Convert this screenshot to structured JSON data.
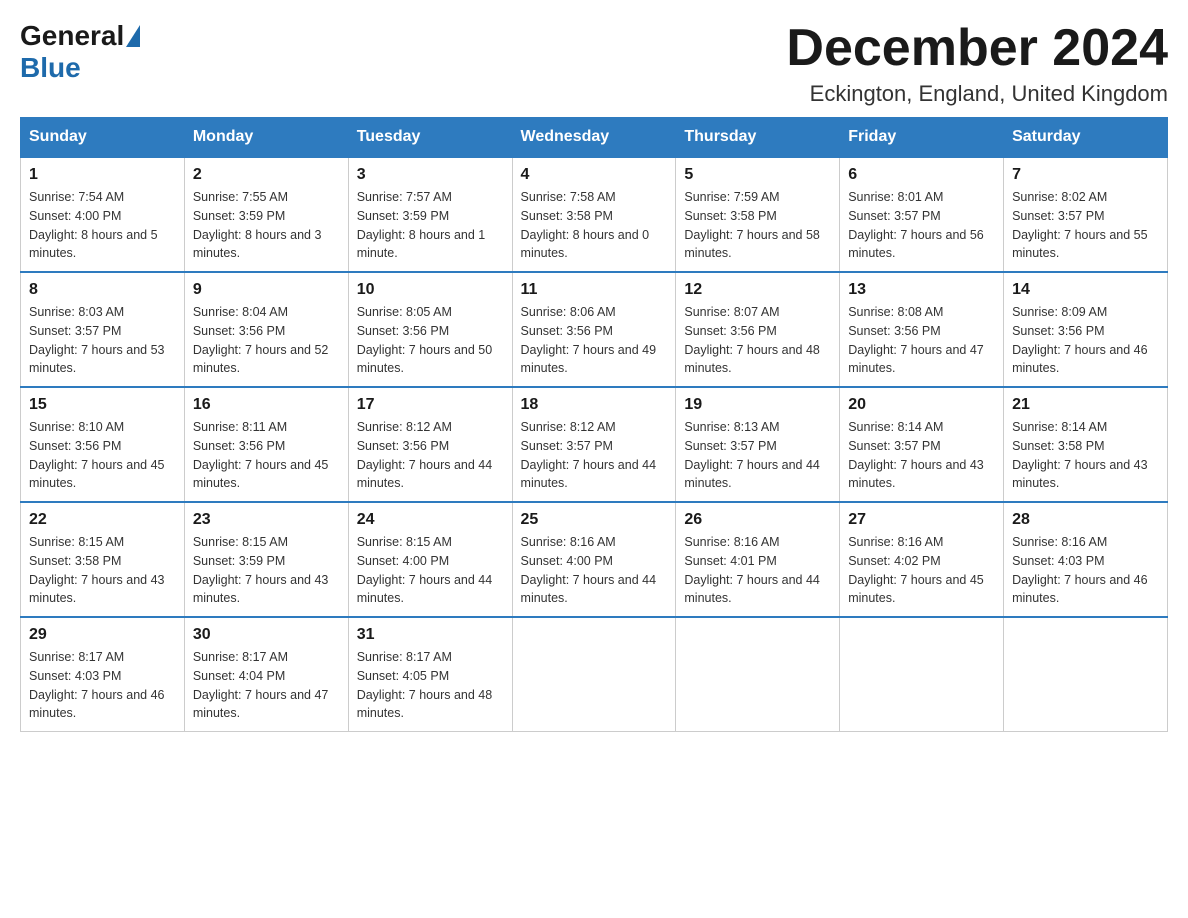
{
  "header": {
    "logo_general": "General",
    "logo_blue": "Blue",
    "month_title": "December 2024",
    "location": "Eckington, England, United Kingdom"
  },
  "days_of_week": [
    "Sunday",
    "Monday",
    "Tuesday",
    "Wednesday",
    "Thursday",
    "Friday",
    "Saturday"
  ],
  "weeks": [
    [
      {
        "day": "1",
        "sunrise": "7:54 AM",
        "sunset": "4:00 PM",
        "daylight": "8 hours and 5 minutes."
      },
      {
        "day": "2",
        "sunrise": "7:55 AM",
        "sunset": "3:59 PM",
        "daylight": "8 hours and 3 minutes."
      },
      {
        "day": "3",
        "sunrise": "7:57 AM",
        "sunset": "3:59 PM",
        "daylight": "8 hours and 1 minute."
      },
      {
        "day": "4",
        "sunrise": "7:58 AM",
        "sunset": "3:58 PM",
        "daylight": "8 hours and 0 minutes."
      },
      {
        "day": "5",
        "sunrise": "7:59 AM",
        "sunset": "3:58 PM",
        "daylight": "7 hours and 58 minutes."
      },
      {
        "day": "6",
        "sunrise": "8:01 AM",
        "sunset": "3:57 PM",
        "daylight": "7 hours and 56 minutes."
      },
      {
        "day": "7",
        "sunrise": "8:02 AM",
        "sunset": "3:57 PM",
        "daylight": "7 hours and 55 minutes."
      }
    ],
    [
      {
        "day": "8",
        "sunrise": "8:03 AM",
        "sunset": "3:57 PM",
        "daylight": "7 hours and 53 minutes."
      },
      {
        "day": "9",
        "sunrise": "8:04 AM",
        "sunset": "3:56 PM",
        "daylight": "7 hours and 52 minutes."
      },
      {
        "day": "10",
        "sunrise": "8:05 AM",
        "sunset": "3:56 PM",
        "daylight": "7 hours and 50 minutes."
      },
      {
        "day": "11",
        "sunrise": "8:06 AM",
        "sunset": "3:56 PM",
        "daylight": "7 hours and 49 minutes."
      },
      {
        "day": "12",
        "sunrise": "8:07 AM",
        "sunset": "3:56 PM",
        "daylight": "7 hours and 48 minutes."
      },
      {
        "day": "13",
        "sunrise": "8:08 AM",
        "sunset": "3:56 PM",
        "daylight": "7 hours and 47 minutes."
      },
      {
        "day": "14",
        "sunrise": "8:09 AM",
        "sunset": "3:56 PM",
        "daylight": "7 hours and 46 minutes."
      }
    ],
    [
      {
        "day": "15",
        "sunrise": "8:10 AM",
        "sunset": "3:56 PM",
        "daylight": "7 hours and 45 minutes."
      },
      {
        "day": "16",
        "sunrise": "8:11 AM",
        "sunset": "3:56 PM",
        "daylight": "7 hours and 45 minutes."
      },
      {
        "day": "17",
        "sunrise": "8:12 AM",
        "sunset": "3:56 PM",
        "daylight": "7 hours and 44 minutes."
      },
      {
        "day": "18",
        "sunrise": "8:12 AM",
        "sunset": "3:57 PM",
        "daylight": "7 hours and 44 minutes."
      },
      {
        "day": "19",
        "sunrise": "8:13 AM",
        "sunset": "3:57 PM",
        "daylight": "7 hours and 44 minutes."
      },
      {
        "day": "20",
        "sunrise": "8:14 AM",
        "sunset": "3:57 PM",
        "daylight": "7 hours and 43 minutes."
      },
      {
        "day": "21",
        "sunrise": "8:14 AM",
        "sunset": "3:58 PM",
        "daylight": "7 hours and 43 minutes."
      }
    ],
    [
      {
        "day": "22",
        "sunrise": "8:15 AM",
        "sunset": "3:58 PM",
        "daylight": "7 hours and 43 minutes."
      },
      {
        "day": "23",
        "sunrise": "8:15 AM",
        "sunset": "3:59 PM",
        "daylight": "7 hours and 43 minutes."
      },
      {
        "day": "24",
        "sunrise": "8:15 AM",
        "sunset": "4:00 PM",
        "daylight": "7 hours and 44 minutes."
      },
      {
        "day": "25",
        "sunrise": "8:16 AM",
        "sunset": "4:00 PM",
        "daylight": "7 hours and 44 minutes."
      },
      {
        "day": "26",
        "sunrise": "8:16 AM",
        "sunset": "4:01 PM",
        "daylight": "7 hours and 44 minutes."
      },
      {
        "day": "27",
        "sunrise": "8:16 AM",
        "sunset": "4:02 PM",
        "daylight": "7 hours and 45 minutes."
      },
      {
        "day": "28",
        "sunrise": "8:16 AM",
        "sunset": "4:03 PM",
        "daylight": "7 hours and 46 minutes."
      }
    ],
    [
      {
        "day": "29",
        "sunrise": "8:17 AM",
        "sunset": "4:03 PM",
        "daylight": "7 hours and 46 minutes."
      },
      {
        "day": "30",
        "sunrise": "8:17 AM",
        "sunset": "4:04 PM",
        "daylight": "7 hours and 47 minutes."
      },
      {
        "day": "31",
        "sunrise": "8:17 AM",
        "sunset": "4:05 PM",
        "daylight": "7 hours and 48 minutes."
      },
      null,
      null,
      null,
      null
    ]
  ]
}
